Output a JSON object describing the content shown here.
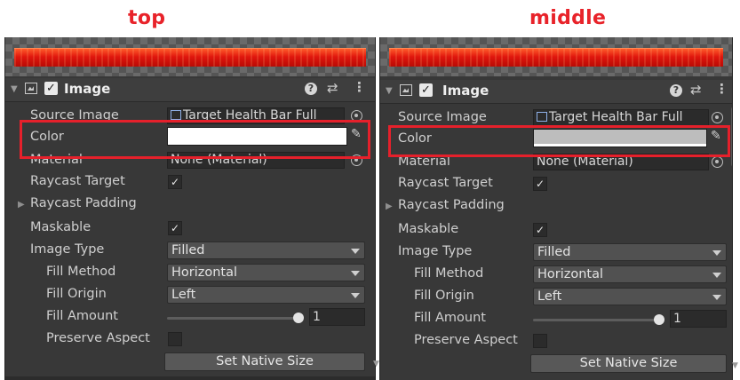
{
  "captions": {
    "left": "top",
    "right": "middle"
  },
  "colors": {
    "highlight": "#e5202b",
    "left_color_value": "#ffffff",
    "right_color_value": "#bdbdbd"
  },
  "component": {
    "title": "Image",
    "enabled": true,
    "icons": [
      "image-component-icon",
      "help-icon",
      "preset-settings-icon",
      "more-menu-icon"
    ]
  },
  "fields": {
    "source_image": {
      "label": "Source Image",
      "value": "Target Health Bar Full"
    },
    "color": {
      "label": "Color"
    },
    "material": {
      "label": "Material",
      "value": "None (Material)"
    },
    "raycast_target": {
      "label": "Raycast Target",
      "checked": true
    },
    "raycast_padding": {
      "label": "Raycast Padding"
    },
    "maskable": {
      "label": "Maskable",
      "checked": true
    },
    "image_type": {
      "label": "Image Type",
      "value": "Filled"
    },
    "fill_method": {
      "label": "Fill Method",
      "value": "Horizontal"
    },
    "fill_origin": {
      "label": "Fill Origin",
      "value": "Left"
    },
    "fill_amount": {
      "label": "Fill Amount",
      "value": "1",
      "slider_fraction": 1.0
    },
    "preserve_aspect": {
      "label": "Preserve Aspect",
      "checked": false
    },
    "set_native_size": {
      "label": "Set Native Size"
    }
  },
  "glyphs": {
    "check": "✓",
    "fold_closed": "▶",
    "fold_open": "▼",
    "more": "⋮",
    "help": "?",
    "settings": "⇄",
    "eyedropper": "✎"
  }
}
